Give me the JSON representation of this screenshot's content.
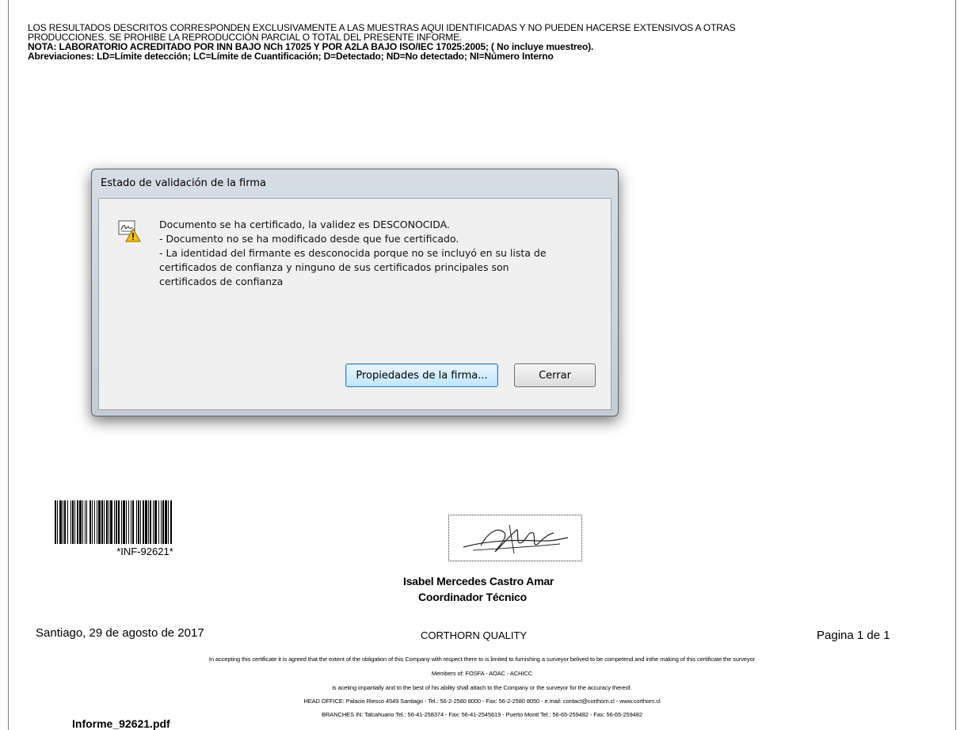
{
  "report_header": {
    "line1": "LOS RESULTADOS DESCRITOS CORRESPONDEN EXCLUSIVAMENTE A LAS MUESTRAS AQUI IDENTIFICADAS Y NO PUEDEN HACERSE EXTENSIVOS A OTRAS",
    "line2": "PRODUCCIONES. SE PROHIBE LA REPRODUCCIÓN PARCIAL O TOTAL DEL PRESENTE INFORME.",
    "line3": "NOTA: LABORATORIO ACREDITADO POR INN BAJO NCh 17025 Y POR A2LA BAJO ISO/IEC 17025:2005; ( No incluye muestreo).",
    "line4": "Abreviaciones: LD=Límite detección; LC=Límite de Cuantificación; D=Detectado; ND=No detectado; NI=Número Interno"
  },
  "dialog": {
    "title": "Estado de validación de la firma",
    "icon": "signature-warning-icon",
    "message_lines": [
      "Documento se ha certificado, la validez es DESCONOCIDA.",
      "- Documento no se ha modificado desde que fue certificado.",
      "- La identidad del firmante es desconocida porque no se incluyó en su lista de",
      "certificados de confianza y ninguno de sus certificados principales son",
      "certificados de confianza"
    ],
    "properties_button": "Propiedades de la firma...",
    "close_button": "Cerrar"
  },
  "barcode": {
    "label": "*INF-92621*"
  },
  "signer": {
    "name": "Isabel Mercedes Castro Amar",
    "role": "Coordinador Técnico"
  },
  "footer": {
    "date": "Santiago, 29 de agosto de 2017",
    "company": "CORTHORN QUALITY",
    "page": "Pagina 1 de 1",
    "disclaimer1": "In accepting this certificate it is agreed that the extent of the obligation of this Company with respect there to is limited to furnishing a surveyor belived to be competend and inthe making of this certificate the surveyor",
    "members": "Members of: FOSFA - AOAC - ACHICC",
    "disclaimer2": "is aceting impartially and to the best of his ability shall attach to the Company or the surveyor for the accuracy thereof.",
    "head_office": "HEAD OFFICE: Palacio Riesco 4549 Santiago - Tel.: 56-2-2580 8000 - Fax: 56-2-2580 8050 - e.mail: contact@corthorn.cl - www.corthorn.cl",
    "branches": "BRANCHES IN: Talcahuano Tel.: 56-41-258374 - Fax: 56-41-2545619 - Puerto Montt Tel.: 56-65-259482 - Fax: 56-65-259482"
  },
  "file_name": "Informe_92621.pdf"
}
